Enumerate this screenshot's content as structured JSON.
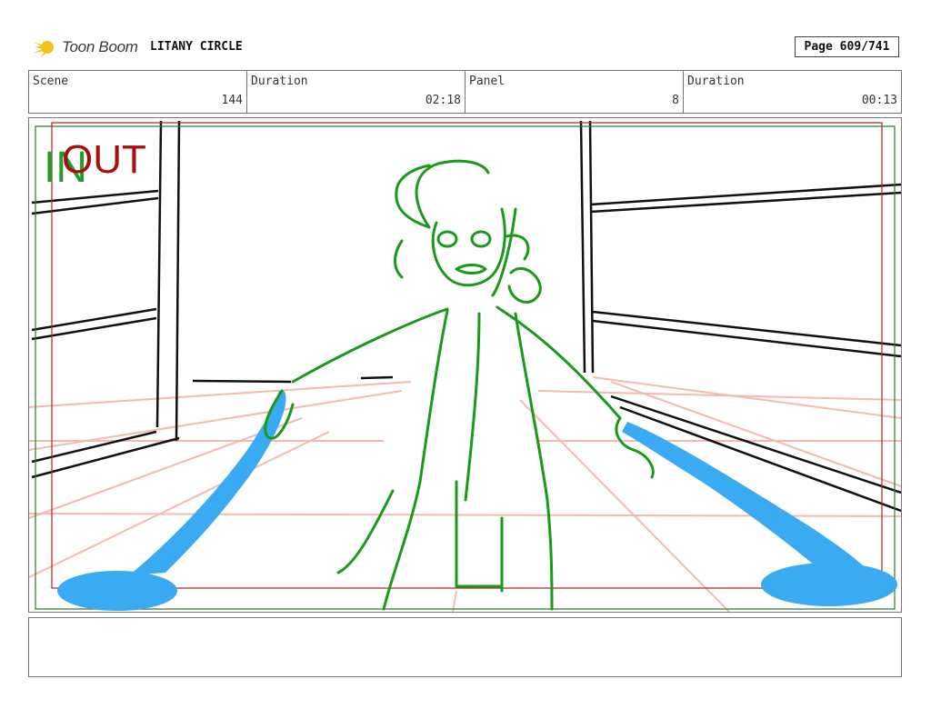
{
  "header": {
    "logo_text": "Toon Boom",
    "project_title": "LITANY CIRCLE",
    "page_label": "Page 609/741"
  },
  "info": {
    "scene_label": "Scene",
    "scene_value": "144",
    "scene_duration_label": "Duration",
    "scene_duration_value": "02:18",
    "panel_label": "Panel",
    "panel_value": "8",
    "panel_duration_label": "Duration",
    "panel_duration_value": "00:13"
  },
  "panel": {
    "in_marker": "IN",
    "out_marker": "OUT"
  },
  "colors": {
    "in_marker": "#1f9e2a",
    "out_marker": "#a80f0f",
    "character": "#1a9a1a",
    "energy": "#3aaaf2",
    "perspective": "#f0b0a0",
    "walls": "#111111"
  },
  "notes": {}
}
